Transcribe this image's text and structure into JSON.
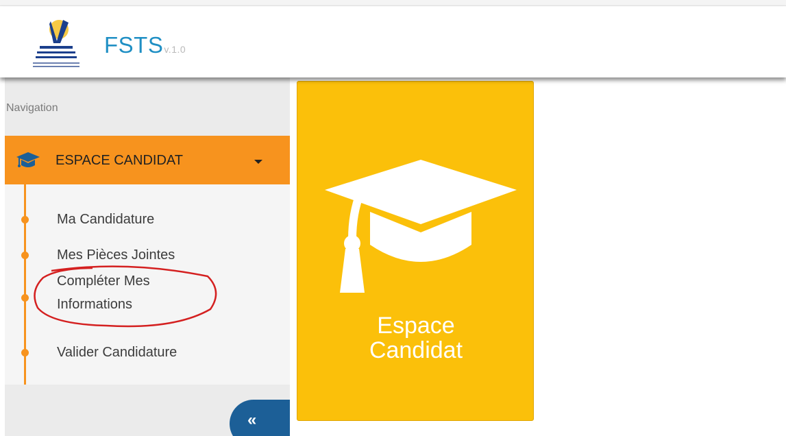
{
  "header": {
    "app_name": "FSTS",
    "version": "v.1.0",
    "logo_icon": "faculty-logo-icon"
  },
  "sidebar": {
    "nav_title": "Navigation",
    "menu": {
      "label": "ESPACE CANDIDAT",
      "icon": "graduation-cap-icon",
      "accent_color": "#f7931e",
      "items": [
        {
          "label": "Ma Candidature"
        },
        {
          "label": "Mes Pièces Jointes"
        },
        {
          "label_line1": "Compléter Mes",
          "label_line2": "Informations"
        },
        {
          "label": "Valider Candidature"
        }
      ]
    },
    "collapse_button": {
      "label": "«",
      "color": "#1c5f97"
    }
  },
  "tile": {
    "label_line1": "Espace",
    "label_line2": "Candidat",
    "icon": "graduation-cap-icon",
    "color": "#fbc00a"
  },
  "annotation": {
    "color": "#d42020"
  }
}
